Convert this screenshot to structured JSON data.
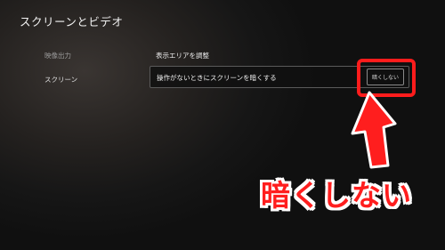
{
  "page": {
    "title": "スクリーンとビデオ"
  },
  "sidebar": {
    "items": [
      {
        "label": "映像出力"
      },
      {
        "label": "スクリーン"
      }
    ]
  },
  "main": {
    "heading": "表示エリアを調整",
    "setting": {
      "label": "操作がないときにスクリーンを暗くする",
      "value": "暗くしない"
    }
  },
  "annotation": {
    "caption": "暗くしない",
    "color": "#ff1e1e"
  }
}
